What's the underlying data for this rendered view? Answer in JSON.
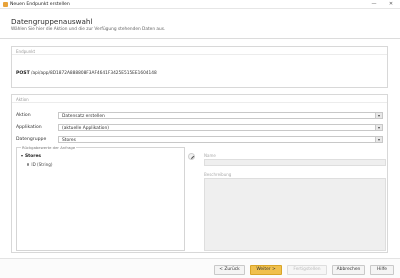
{
  "window": {
    "title": "Neuen Endpunkt erstellen",
    "minimize": "—",
    "close": "✕"
  },
  "header": {
    "title": "Datengruppenauswahl",
    "subtitle": "Wählen Sie hier die Aktion und die zur Verfügung stehenden Daten aus."
  },
  "endpoint": {
    "section_label": "Endpunkt",
    "method": "POST",
    "url": "/api/app/8D1872A888808F3AF4641F3425E515EE1604148"
  },
  "action_section": {
    "section_label": "Aktion",
    "fields": [
      {
        "label": "Aktion",
        "value": "Datensatz erstellen"
      },
      {
        "label": "Applikation",
        "value": "(aktuelle Applikation)"
      },
      {
        "label": "Datengruppe",
        "value": "Stores"
      }
    ],
    "fieldset_legend": "Rückgabewerte der Anfrage",
    "tree": {
      "root": "Stores",
      "child": "ID (String)"
    },
    "name_label": "Name",
    "description_label": "Beschreibung"
  },
  "footer": {
    "back": "< Zurück",
    "next": "Weiter >",
    "finish": "Fertigstellen",
    "cancel": "Abbrechen",
    "help": "Hilfe"
  },
  "colors": {
    "primary_button": "#f0c04d",
    "app_icon": "#e8a33a"
  }
}
